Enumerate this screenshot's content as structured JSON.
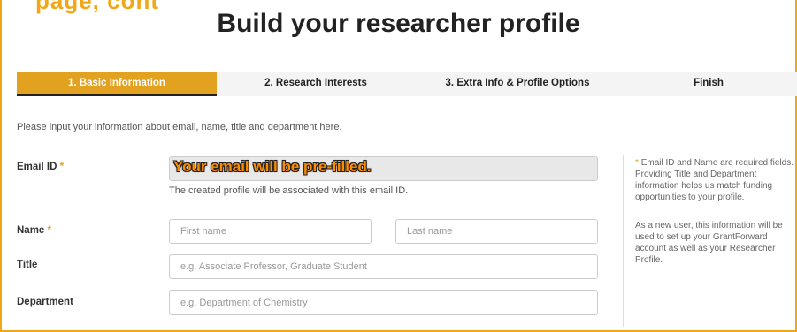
{
  "page": {
    "cropped_header": "page, cont",
    "title": "Build your researcher profile"
  },
  "steps": [
    {
      "label": "1. Basic Information",
      "active": true
    },
    {
      "label": "2. Research Interests",
      "active": false
    },
    {
      "label": "3. Extra Info & Profile Options",
      "active": false
    },
    {
      "label": "Finish",
      "active": false
    }
  ],
  "form": {
    "intro": "Please input your information about email, name, title and department here.",
    "required_mark": "*",
    "email": {
      "label": "Email ID",
      "overlay_text": "Your email will be pre-filled.",
      "help": "The created profile will be associated with this email ID."
    },
    "name": {
      "label": "Name",
      "first_placeholder": "First name",
      "last_placeholder": "Last name"
    },
    "title": {
      "label": "Title",
      "placeholder": "e.g. Associate Professor, Graduate Student"
    },
    "department": {
      "label": "Department",
      "placeholder": "e.g. Department of Chemistry"
    }
  },
  "sidebar": {
    "note_1": "Email ID and Name are required fields. Providing Title and Department information helps us match funding opportunities to your profile.",
    "note_2": "As a new user, this information will be used to set up your GrantForward account as well as your Researcher Profile."
  },
  "colors": {
    "accent": "#e2a11f",
    "frame": "#f0a818",
    "overlay_text": "#ff8c00"
  }
}
